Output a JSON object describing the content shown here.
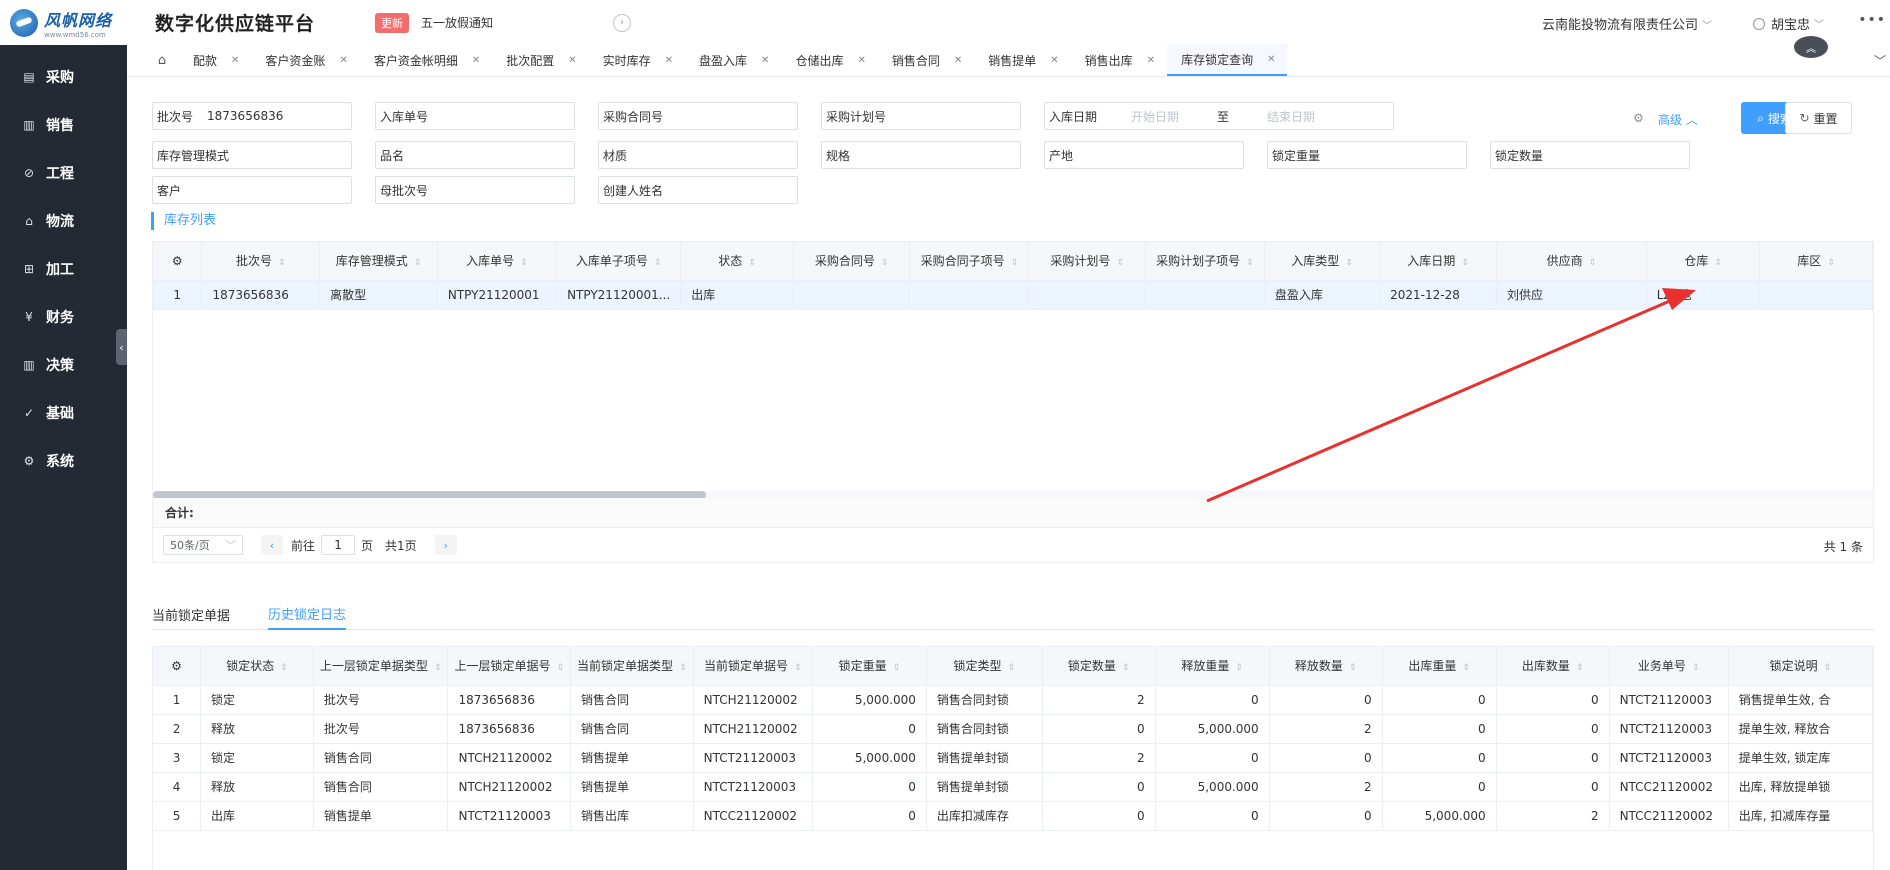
{
  "brand": {
    "logo_text": "风帆网络",
    "logo_url": "www.wmd56.com"
  },
  "app_title": "数字化供应链平台",
  "notice": {
    "badge": "更新",
    "text": "五一放假通知"
  },
  "company": "云南能投物流有限责任公司",
  "user": "胡宝忠",
  "more": "•••",
  "sidebar": {
    "items": [
      {
        "label": "采购",
        "icon": "purchase-icon",
        "glyph": "▤"
      },
      {
        "label": "销售",
        "icon": "sales-chart-icon",
        "glyph": "▥"
      },
      {
        "label": "工程",
        "icon": "compass-icon",
        "glyph": "⊘"
      },
      {
        "label": "物流",
        "icon": "home-icon",
        "glyph": "⌂"
      },
      {
        "label": "加工",
        "icon": "grid-icon",
        "glyph": "⊞"
      },
      {
        "label": "财务",
        "icon": "yen-icon",
        "glyph": "¥"
      },
      {
        "label": "决策",
        "icon": "bar-chart-icon",
        "glyph": "▥"
      },
      {
        "label": "基础",
        "icon": "check-circle-icon",
        "glyph": "✓"
      },
      {
        "label": "系统",
        "icon": "gear-icon",
        "glyph": "⚙"
      }
    ]
  },
  "tabs": [
    {
      "label": "配款"
    },
    {
      "label": "客户资金账"
    },
    {
      "label": "客户资金帐明细"
    },
    {
      "label": "批次配置"
    },
    {
      "label": "实时库存"
    },
    {
      "label": "盘盈入库"
    },
    {
      "label": "仓储出库"
    },
    {
      "label": "销售合同"
    },
    {
      "label": "销售提单"
    },
    {
      "label": "销售出库"
    },
    {
      "label": "库存锁定查询"
    }
  ],
  "filters": {
    "batch_no": {
      "label": "批次号",
      "value": "1873656836"
    },
    "inbound_no": {
      "label": "入库单号"
    },
    "purchase_contract_no": {
      "label": "采购合同号"
    },
    "purchase_plan_no": {
      "label": "采购计划号"
    },
    "inbound_date": {
      "label": "入库日期",
      "start_placeholder": "开始日期",
      "sep": "至",
      "end_placeholder": "结束日期"
    },
    "inventory_mode": {
      "label": "库存管理模式"
    },
    "product_name": {
      "label": "品名"
    },
    "material": {
      "label": "材质"
    },
    "spec": {
      "label": "规格"
    },
    "origin": {
      "label": "产地"
    },
    "locked_weight": {
      "label": "锁定重量"
    },
    "locked_qty": {
      "label": "锁定数量"
    },
    "customer": {
      "label": "客户"
    },
    "parent_batch_no": {
      "label": "母批次号"
    },
    "creator_name": {
      "label": "创建人姓名"
    },
    "advanced_label": "高级",
    "search_label": "搜索",
    "reset_label": "重置"
  },
  "inventory_section_title": "库存列表",
  "inventory_table": {
    "headers": [
      "批次号",
      "库存管理模式",
      "入库单号",
      "入库单子项号",
      "状态",
      "采购合同号",
      "采购合同子项号",
      "采购计划号",
      "采购计划子项号",
      "入库类型",
      "入库日期",
      "供应商",
      "仓库",
      "库区"
    ],
    "rows": [
      [
        "1",
        "1873656836",
        "离散型",
        "NTPY21120001",
        "NTPY21120001...",
        "出库",
        "",
        "",
        "",
        "",
        "盘盈入库",
        "2021-12-28",
        "刘供应",
        "LZH仓",
        ""
      ]
    ],
    "summary_label": "合计:"
  },
  "pagination": {
    "page_size": "50条/页",
    "goto_label": "前往",
    "page_value": "1",
    "page_unit": "页",
    "total_pages": "共1页",
    "total_records": "共 1 条"
  },
  "lower_tabs": [
    {
      "label": "当前锁定单据",
      "active": false
    },
    {
      "label": "历史锁定日志",
      "active": true
    }
  ],
  "log_table": {
    "headers": [
      "锁定状态",
      "上一层锁定单据类型",
      "上一层锁定单据号",
      "当前锁定单据类型",
      "当前锁定单据号",
      "锁定重量",
      "锁定类型",
      "锁定数量",
      "释放重量",
      "释放数量",
      "出库重量",
      "出库数量",
      "业务单号",
      "锁定说明"
    ],
    "rows": [
      [
        "1",
        "锁定",
        "批次号",
        "1873656836",
        "销售合同",
        "NTCH21120002",
        "5,000.000",
        "销售合同封锁",
        "2",
        "0",
        "0",
        "0",
        "0",
        "NTCT21120003",
        "销售提单生效, 合"
      ],
      [
        "2",
        "释放",
        "批次号",
        "1873656836",
        "销售合同",
        "NTCH21120002",
        "0",
        "销售合同封锁",
        "0",
        "5,000.000",
        "2",
        "0",
        "0",
        "NTCT21120003",
        "提单生效, 释放合"
      ],
      [
        "3",
        "锁定",
        "销售合同",
        "NTCH21120002",
        "销售提单",
        "NTCT21120003",
        "5,000.000",
        "销售提单封锁",
        "2",
        "0",
        "0",
        "0",
        "0",
        "NTCT21120003",
        "提单生效, 锁定库"
      ],
      [
        "4",
        "释放",
        "销售合同",
        "NTCH21120002",
        "销售提单",
        "NTCT21120003",
        "0",
        "销售提单封锁",
        "0",
        "5,000.000",
        "2",
        "0",
        "0",
        "NTCC21120002",
        "出库, 释放提单锁"
      ],
      [
        "5",
        "出库",
        "销售提单",
        "NTCT21120003",
        "销售出库",
        "NTCC21120002",
        "0",
        "出库扣减库存",
        "0",
        "0",
        "0",
        "5,000.000",
        "2",
        "NTCC21120002",
        "出库, 扣减库存量"
      ]
    ]
  },
  "colors": {
    "sidebar_bg": "#232a33",
    "accent": "#409eff",
    "badge_red": "#f56c6c",
    "annotation_arrow": "#e8312f"
  }
}
